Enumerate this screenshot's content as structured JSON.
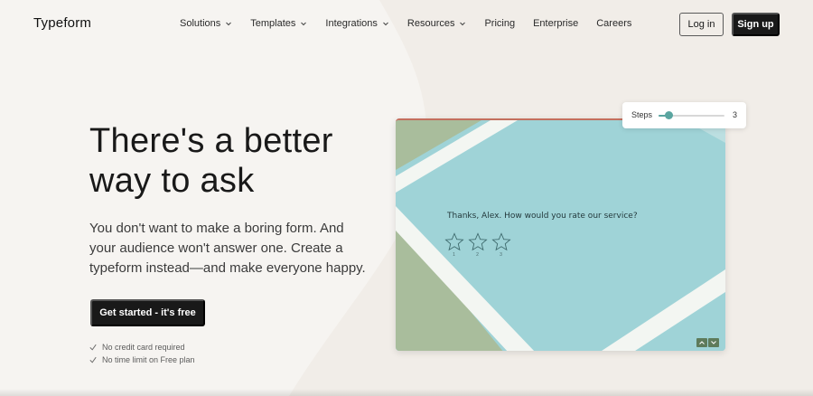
{
  "header": {
    "logo": "Typeform",
    "nav": [
      {
        "label": "Solutions",
        "has_dropdown": true
      },
      {
        "label": "Templates",
        "has_dropdown": true
      },
      {
        "label": "Integrations",
        "has_dropdown": true
      },
      {
        "label": "Resources",
        "has_dropdown": true
      },
      {
        "label": "Pricing",
        "has_dropdown": false
      },
      {
        "label": "Enterprise",
        "has_dropdown": false
      },
      {
        "label": "Careers",
        "has_dropdown": false
      }
    ],
    "login_label": "Log in",
    "signup_label": "Sign up"
  },
  "hero": {
    "headline": "There's a better way to ask",
    "subtext": "You don't want to make a boring form. And your audience won't answer one. Create a typeform instead—and make everyone happy.",
    "cta_label": "Get started - it's free",
    "perks": [
      "No credit card required",
      "No time limit on Free plan"
    ]
  },
  "preview": {
    "question": "Thanks, Alex. How would you rate our service?",
    "stars": [
      {
        "number": "1"
      },
      {
        "number": "2"
      },
      {
        "number": "3"
      }
    ],
    "up_icon": "chevron-up-icon",
    "down_icon": "chevron-down-icon"
  },
  "steps_widget": {
    "label": "Steps",
    "value": "3",
    "slider_fraction": 0.15
  },
  "colors": {
    "background": "#f6f4f1",
    "dark_button": "#191919",
    "preview_teal": "#9fd3d7",
    "accent_teal": "#5aa5a0",
    "olive": "#5e7b5b"
  }
}
